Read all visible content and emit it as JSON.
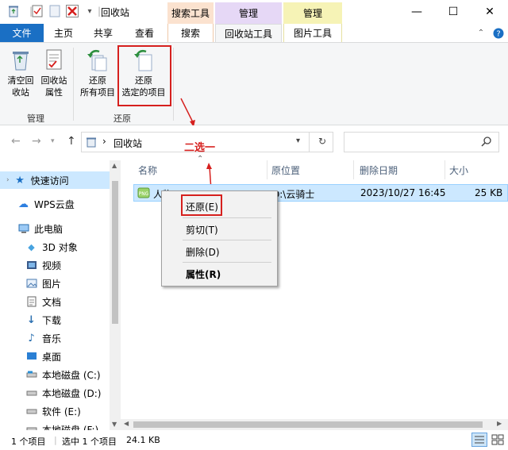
{
  "window": {
    "title": "回收站",
    "contextual_headers": [
      "搜索工具",
      "管理",
      "管理"
    ],
    "controls": {
      "minimize": "—",
      "maximize": "☐",
      "close": "✕"
    }
  },
  "tabs": [
    "文件",
    "主页",
    "共享",
    "查看",
    "搜索",
    "回收站工具",
    "图片工具"
  ],
  "ribbon": {
    "manage_group": {
      "label": "管理",
      "buttons": [
        {
          "line1": "清空回",
          "line2": "收站",
          "icon": "empty-recycle-bin-icon"
        },
        {
          "line1": "回收站",
          "line2": "属性",
          "icon": "recycle-bin-properties-icon"
        }
      ]
    },
    "restore_group": {
      "label": "还原",
      "buttons": [
        {
          "line1": "还原",
          "line2": "所有项目",
          "icon": "restore-all-icon"
        },
        {
          "line1": "还原",
          "line2": "选定的项目",
          "icon": "restore-selected-icon"
        }
      ]
    }
  },
  "address": {
    "path": "回收站",
    "separator": "›",
    "search_placeholder": ""
  },
  "annotation": "二选一",
  "nav_pane": {
    "items": [
      {
        "label": "快速访问",
        "icon": "star-icon"
      },
      {
        "label": "WPS云盘",
        "icon": "cloud-icon"
      },
      {
        "label": "此电脑",
        "icon": "computer-icon"
      },
      {
        "label": "3D 对象",
        "icon": "3d-objects-icon"
      },
      {
        "label": "视频",
        "icon": "video-icon"
      },
      {
        "label": "图片",
        "icon": "pictures-icon"
      },
      {
        "label": "文档",
        "icon": "documents-icon"
      },
      {
        "label": "下载",
        "icon": "download-icon"
      },
      {
        "label": "音乐",
        "icon": "music-icon"
      },
      {
        "label": "桌面",
        "icon": "desktop-icon"
      },
      {
        "label": "本地磁盘 (C:)",
        "icon": "drive-icon"
      },
      {
        "label": "本地磁盘 (D:)",
        "icon": "drive-icon"
      },
      {
        "label": "软件 (E:)",
        "icon": "drive-icon"
      },
      {
        "label": "本地磁盘 (F:)",
        "icon": "drive-icon"
      }
    ]
  },
  "file_list": {
    "columns": [
      "名称",
      "原位置",
      "删除日期",
      "大小"
    ],
    "rows": [
      {
        "name": "人物",
        "location": "D:\\云骑士",
        "deleted": "2023/10/27 16:45",
        "size": "25 KB"
      }
    ]
  },
  "context_menu": {
    "items": [
      "还原(E)",
      "剪切(T)",
      "删除(D)",
      "属性(R)"
    ]
  },
  "status_bar": {
    "item_count": "1 个项目",
    "selected": "选中 1 个项目",
    "size": "24.1 KB"
  },
  "colors": {
    "accent": "#1a6fc4",
    "highlight_red": "#d6201e",
    "selection": "#cce8ff"
  }
}
